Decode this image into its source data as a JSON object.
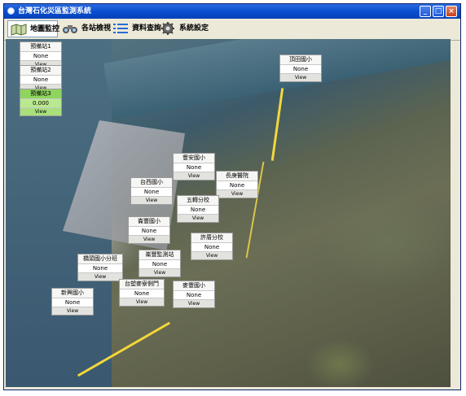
{
  "window": {
    "title": "台灣石化災區監測系統"
  },
  "toolbar": {
    "items": [
      {
        "label": "地圖監控",
        "icon": "map-icon"
      },
      {
        "label": "各站檢視",
        "icon": "binoculars-icon"
      },
      {
        "label": "資料查詢",
        "icon": "list-icon"
      },
      {
        "label": "系統設定",
        "icon": "gear-icon"
      }
    ]
  },
  "colors": {
    "titlebar": "#0a4fd0",
    "active_station": "#8ed45d",
    "road": "#f4d73a"
  },
  "stations": [
    {
      "name": "預備站1",
      "value": "None",
      "button": "View"
    },
    {
      "name": "預備站2",
      "value": "None",
      "button": "View"
    },
    {
      "name": "預備站3",
      "value": "0.000",
      "button": "View"
    },
    {
      "name": "頂田國小",
      "value": "None",
      "button": "View"
    },
    {
      "name": "豐安國小",
      "value": "None",
      "button": "View"
    },
    {
      "name": "長庚醫院",
      "value": "None",
      "button": "View"
    },
    {
      "name": "台西國小",
      "value": "None",
      "button": "View"
    },
    {
      "name": "五轉分校",
      "value": "None",
      "button": "View"
    },
    {
      "name": "崙豐國小",
      "value": "None",
      "button": "View"
    },
    {
      "name": "許厝分校",
      "value": "None",
      "button": "View"
    },
    {
      "name": "橋頭國小分班",
      "value": "None",
      "button": "View"
    },
    {
      "name": "崙豐監測站",
      "value": "None",
      "button": "View"
    },
    {
      "name": "新興國小",
      "value": "None",
      "button": "View"
    },
    {
      "name": "台塑麥寮側門",
      "value": "None",
      "button": "View"
    },
    {
      "name": "麥豐國小",
      "value": "None",
      "button": "View"
    }
  ]
}
